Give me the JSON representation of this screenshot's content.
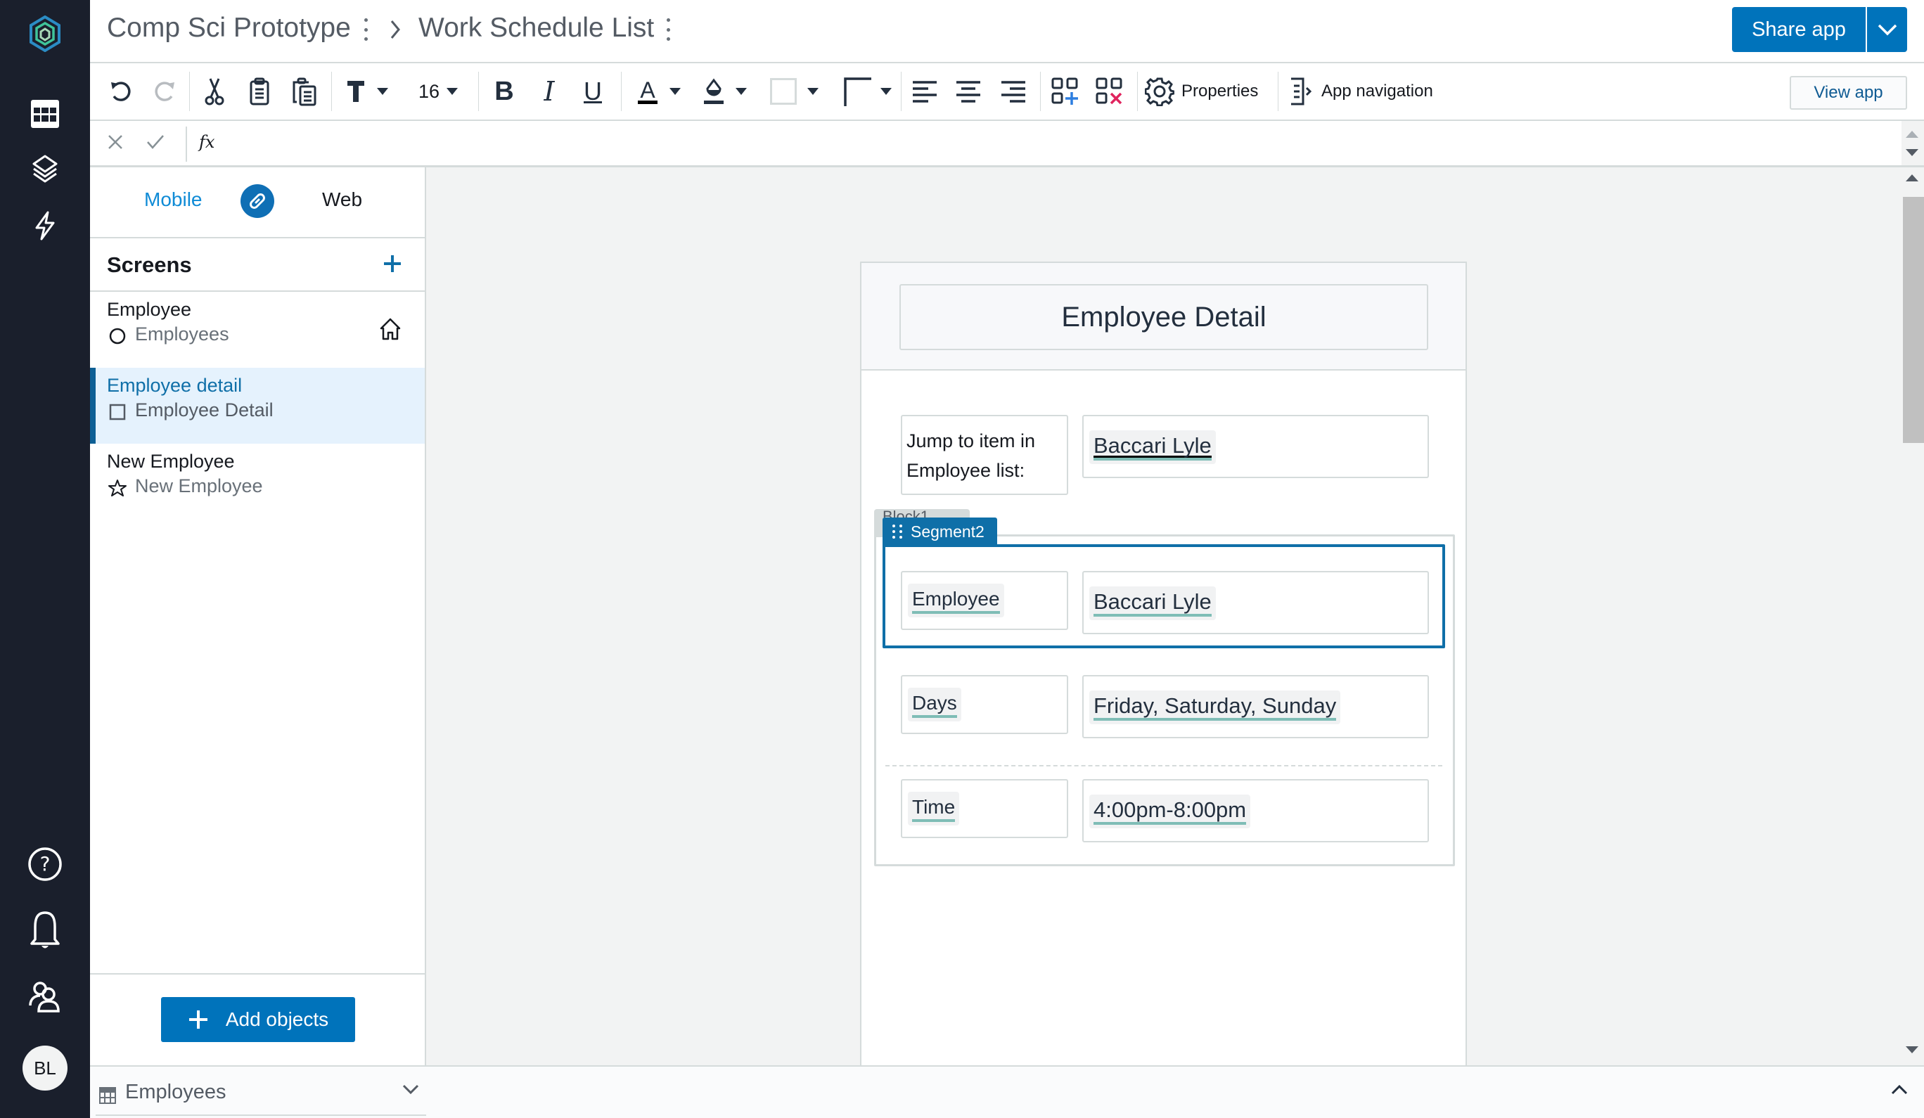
{
  "header": {
    "app_name": "Comp Sci Prototype",
    "table_name": "Work Schedule List",
    "share_label": "Share app"
  },
  "rail": {
    "icons": [
      "app-logo",
      "tables-icon",
      "layers-icon",
      "automation-icon",
      "help-icon",
      "notifications-icon",
      "users-icon"
    ],
    "avatar_initials": "BL"
  },
  "toolbar": {
    "font_size": "16",
    "properties_label": "Properties",
    "app_navigation_label": "App navigation",
    "view_app_label": "View app"
  },
  "formula": {
    "fx_label": "fx",
    "value": ""
  },
  "panel": {
    "tabs": {
      "mobile": "Mobile",
      "web": "Web",
      "active": "Mobile"
    },
    "screens_title": "Screens",
    "screens": [
      {
        "name": "Employee",
        "subtitle": "Employees",
        "icon": "circle",
        "home": true,
        "selected": false
      },
      {
        "name": "Employee detail",
        "subtitle": "Employee Detail",
        "icon": "square",
        "home": false,
        "selected": true
      },
      {
        "name": "New Employee",
        "subtitle": "New Employee",
        "icon": "star",
        "home": false,
        "selected": false
      }
    ],
    "add_objects_label": "Add objects"
  },
  "bottom_bar": {
    "table_label": "Employees"
  },
  "canvas": {
    "screen_title": "Employee Detail",
    "jump_label": "Jump to item in Employee list:",
    "jump_value": "Baccari Lyle",
    "block_tag": "Block1",
    "segment_tag": "Segment2",
    "fields": [
      {
        "label": "Employee",
        "value": "Baccari Lyle"
      },
      {
        "label": "Days",
        "value": "Friday, Saturday, Sunday"
      },
      {
        "label": "Time",
        "value": "4:00pm-8:00pm"
      }
    ]
  },
  "colors": {
    "accent": "#0073bb",
    "rail_bg": "#1a1f2c",
    "selected_bg": "#e5f2fd",
    "field_underline": "#7fbdb6"
  }
}
